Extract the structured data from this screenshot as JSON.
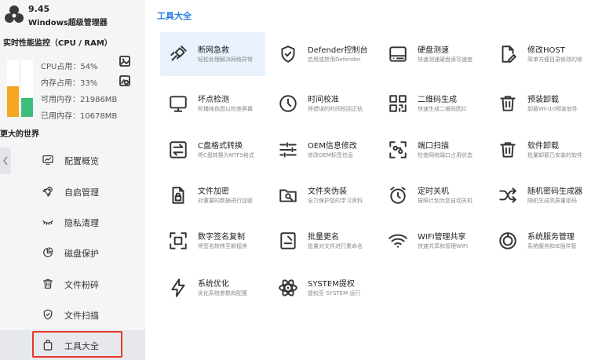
{
  "app": {
    "version": "9.45",
    "name": "Windows超级管理器"
  },
  "monitor": {
    "title": "实时性能监控（CPU / RAM）",
    "cpu_label": "CPU占用：54%",
    "mem_label": "内存占用：33%",
    "avail_label": "可用内存：21986MB",
    "used_label": "已用内存：10678MB",
    "cpu_percent": 54,
    "mem_percent": 33,
    "cpu_color": "#f5a623",
    "mem_color": "#3cbf7a"
  },
  "sidebar": {
    "section_label": "更大的世界",
    "items": [
      {
        "label": "配置概览",
        "icon": "monitor-chart-icon"
      },
      {
        "label": "自启管理",
        "icon": "rocket-icon"
      },
      {
        "label": "隐私清理",
        "icon": "eye-closed-icon"
      },
      {
        "label": "磁盘保护",
        "icon": "pie-chart-icon"
      },
      {
        "label": "文件粉碎",
        "icon": "trash-icon"
      },
      {
        "label": "文件扫描",
        "icon": "shield-check-icon"
      },
      {
        "label": "工具大全",
        "icon": "bag-icon"
      }
    ],
    "active_index": 6
  },
  "main": {
    "title": "工具大全",
    "accent": "#2a7de1",
    "tools": [
      {
        "name": "断网急救",
        "desc": "轻松处理解决网络异常",
        "icon": "plug-icon"
      },
      {
        "name": "Defender控制台",
        "desc": "启用或禁用Defender",
        "icon": "shield-check-icon"
      },
      {
        "name": "硬盘测速",
        "desc": "快速测速硬盘读写速度",
        "icon": "hard-drive-icon"
      },
      {
        "name": "修改HOST",
        "desc": "简单方便目录修改的修",
        "icon": "file-edit-icon"
      },
      {
        "name": "坏点检测",
        "desc": "轮播纯色图以检查屏幕",
        "icon": "monitor-icon"
      },
      {
        "name": "时间校准",
        "desc": "将错误的时间校回正轨",
        "icon": "clock-icon"
      },
      {
        "name": "二维码生成",
        "desc": "快速生成二维码图片",
        "icon": "qr-code-icon"
      },
      {
        "name": "预装卸载",
        "desc": "卸载Win10预装软件",
        "icon": "trash-icon"
      },
      {
        "name": "C盘格式转换",
        "desc": "将C盘转换为NTFS格式",
        "icon": "swap-icon"
      },
      {
        "name": "OEM信息修改",
        "desc": "修改OEM标签信息",
        "icon": "sliders-icon"
      },
      {
        "name": "端口扫描",
        "desc": "检查网络端口占用状态",
        "icon": "scan-icon"
      },
      {
        "name": "软件卸载",
        "desc": "批量卸载已安装的软件",
        "icon": "trash-icon"
      },
      {
        "name": "文件加密",
        "desc": "对重要的数据进行加密",
        "icon": "file-lock-icon"
      },
      {
        "name": "文件夹伪装",
        "desc": "全力保护您的学习资料",
        "icon": "folder-search-icon"
      },
      {
        "name": "定时关机",
        "desc": "按照计划为您自动关机",
        "icon": "alarm-icon"
      },
      {
        "name": "随机密码生成器",
        "desc": "随机生成高质量密码",
        "icon": "shuffle-icon"
      },
      {
        "name": "数字签名复制",
        "desc": "将签名转移至新程序",
        "icon": "copy-frame-icon"
      },
      {
        "name": "批量更名",
        "desc": "批量对文件进行重命名",
        "icon": "file-rename-icon"
      },
      {
        "name": "WIFI管理共享",
        "desc": "快速共享和管理WIFI",
        "icon": "wifi-icon"
      },
      {
        "name": "系统服务管理",
        "desc": "系统服务和IE插件管",
        "icon": "service-icon"
      },
      {
        "name": "系统优化",
        "desc": "优化系统参数和配置",
        "icon": "lightning-icon"
      },
      {
        "name": "SYSTEM提权",
        "desc": "提权至 SYSTEM 运行",
        "icon": "atom-icon"
      }
    ],
    "active_tool_index": 0
  }
}
